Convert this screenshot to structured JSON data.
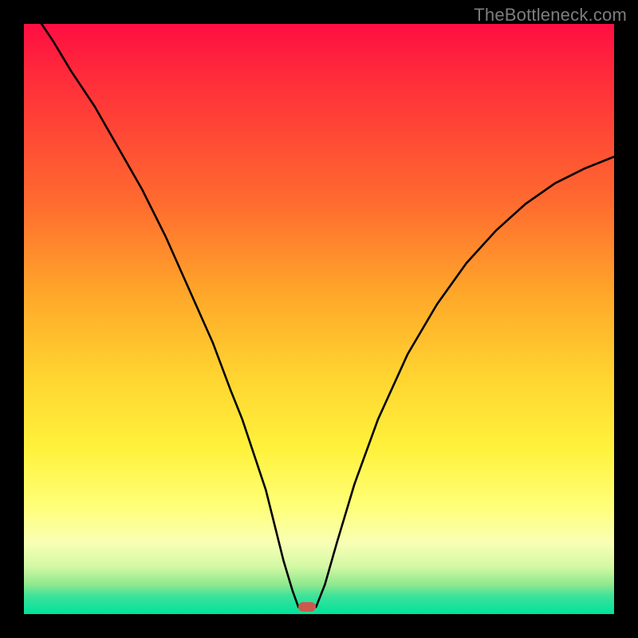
{
  "watermark": {
    "text": "TheBottleneck.com"
  },
  "colors": {
    "curve": "#000000",
    "marker": "#cc594e",
    "frame": "#000000"
  },
  "chart_data": {
    "type": "line",
    "title": "",
    "xlabel": "",
    "ylabel": "",
    "xlim": [
      0,
      100
    ],
    "ylim": [
      0,
      100
    ],
    "x": [
      0,
      3,
      5,
      8,
      12,
      16,
      20,
      24,
      28,
      32,
      35,
      37,
      39,
      41,
      42.5,
      44,
      45.5,
      46.5,
      49.5,
      51,
      53,
      56,
      60,
      65,
      70,
      75,
      80,
      85,
      90,
      95,
      100
    ],
    "values": [
      103.5,
      100,
      97,
      92,
      86,
      79,
      72,
      64,
      55,
      46,
      38,
      33,
      27,
      21,
      15,
      9,
      4,
      1.2,
      1.2,
      5,
      12,
      22,
      33,
      44,
      52.5,
      59.5,
      65,
      69.5,
      73,
      75.5,
      77.5
    ],
    "minimum": {
      "x": 48,
      "y": 1.2
    },
    "gradient_stops": [
      {
        "pos": 0.0,
        "color": "#ff0e42"
      },
      {
        "pos": 0.1,
        "color": "#ff2f3a"
      },
      {
        "pos": 0.3,
        "color": "#ff6a2f"
      },
      {
        "pos": 0.46,
        "color": "#ffa82a"
      },
      {
        "pos": 0.6,
        "color": "#ffd530"
      },
      {
        "pos": 0.72,
        "color": "#fff23c"
      },
      {
        "pos": 0.82,
        "color": "#ffff7a"
      },
      {
        "pos": 0.88,
        "color": "#f8ffb5"
      },
      {
        "pos": 0.92,
        "color": "#d2f8a4"
      },
      {
        "pos": 0.95,
        "color": "#8ee88e"
      },
      {
        "pos": 0.97,
        "color": "#3be29a"
      },
      {
        "pos": 1.0,
        "color": "#00e39a"
      }
    ]
  }
}
